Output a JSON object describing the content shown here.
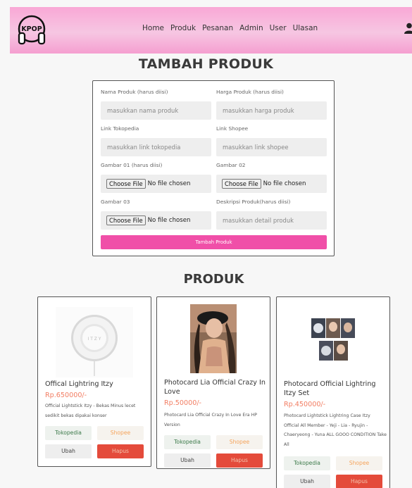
{
  "nav": {
    "logo_text": "KPOP",
    "links": [
      "Home",
      "Produk",
      "Pesanan",
      "Admin",
      "User",
      "Ulasan"
    ]
  },
  "page_title": "TAMBAH PRODUK",
  "form": {
    "nama_label": "Nama Produk (harus diisi)",
    "nama_placeholder": "masukkan nama produk",
    "harga_label": "Harga Produk (harus diisi)",
    "harga_placeholder": "masukkan harga produk",
    "tokopedia_label": "Link Tokopedia",
    "tokopedia_placeholder": "masukkan link tokopedia",
    "shopee_label": "Link Shopee",
    "shopee_placeholder": "masukkan link shopee",
    "gambar1_label": "Gambar 01 (harus diisi)",
    "gambar2_label": "Gambar 02",
    "gambar3_label": "Gambar 03",
    "deskripsi_label": "Deskripsi Produk(harus diisi)",
    "deskripsi_placeholder": "masukkan detail produk",
    "choose_file": "Choose File",
    "no_file": "No file chosen",
    "submit": "Tambah Produk"
  },
  "section_title": "PRODUK",
  "buttons": {
    "tokopedia": "Tokopedia",
    "shopee": "Shopee",
    "ubah": "Ubah",
    "hapus": "Hapus"
  },
  "products": [
    {
      "name": "Offical Lightring Itzy",
      "price": "Rp.650000/-",
      "description": "Official Lightstick Itzy - Bekas Minus lecet sedikit bekas dipakai konser"
    },
    {
      "name": "Photocard Lia Official Crazy In Love",
      "price": "Rp.50000/-",
      "description": "Photocard Lia Official Crazy In Love Era HP Version"
    },
    {
      "name": "Photocard Official Lightring Itzy Set",
      "price": "Rp.450000/-",
      "description": "Photocard Lightstick Lightring Case Itzy Official All Member - Yeji - Lia - Ryujin - Chaeryeong - Yuna ALL GOOO CONDITION Take All"
    }
  ]
}
